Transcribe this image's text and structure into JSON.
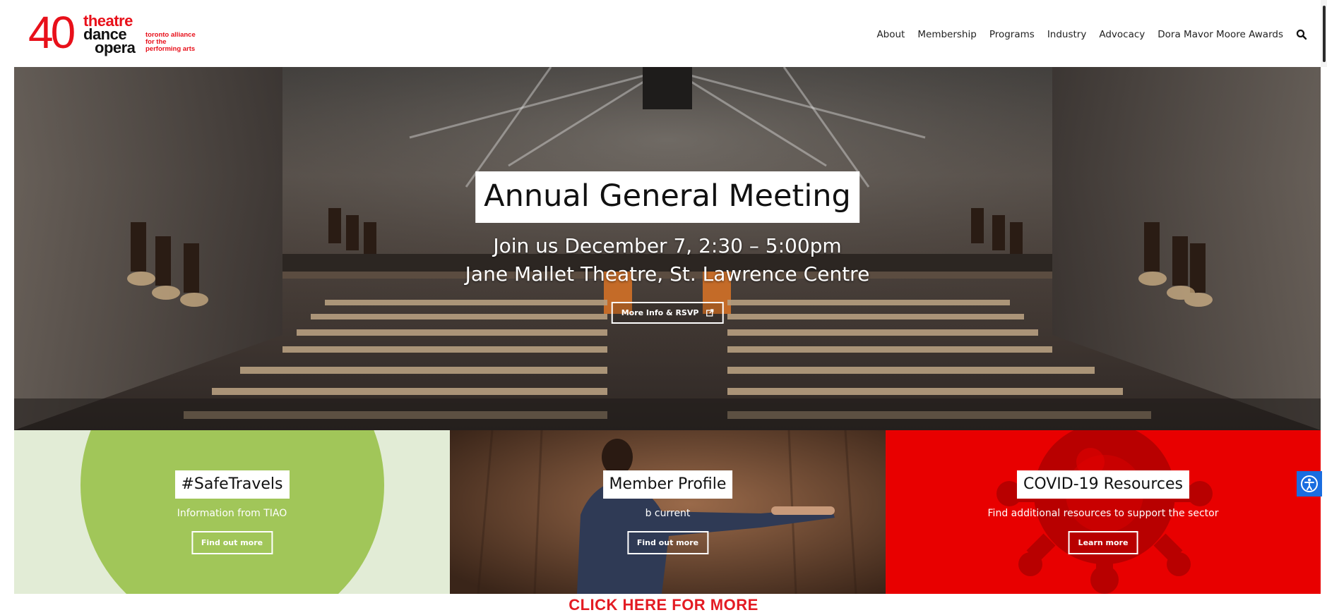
{
  "logo": {
    "number": "40",
    "words": [
      "theatre",
      "dance",
      "opera"
    ],
    "tagline": [
      "toronto alliance",
      "for the",
      "performing arts"
    ]
  },
  "nav": {
    "items": [
      "About",
      "Membership",
      "Programs",
      "Industry",
      "Advocacy",
      "Dora Mavor Moore Awards"
    ],
    "search_icon": "search-icon"
  },
  "hero": {
    "title": "Annual General Meeting",
    "subtitle_line1": "Join us December 7, 2:30 – 5:00pm",
    "subtitle_line2": "Jane Mallet Theatre, St. Lawrence Centre",
    "button_label": "More Info & RSVP",
    "button_icon": "external-link-icon"
  },
  "cards": [
    {
      "title": "#SafeTravels",
      "subtitle": "Information from TIAO",
      "button_label": "Find out more",
      "color": "#e2ecd6",
      "accent": "#a1c659"
    },
    {
      "title": "Member Profile",
      "subtitle": "b current",
      "button_label": "Find out more",
      "color": "#4a3124"
    },
    {
      "title": "COVID-19 Resources",
      "subtitle": "Find additional resources to support the sector",
      "button_label": "Learn more",
      "color": "#e80000",
      "accent": "#b80000"
    }
  ],
  "accessibility_button": {
    "icon": "accessibility-icon",
    "color": "#1a6de0"
  },
  "footer_cta": {
    "label": "CLICK HERE FOR MORE",
    "color": "#e31b23"
  },
  "brand_color": "#e8101a"
}
